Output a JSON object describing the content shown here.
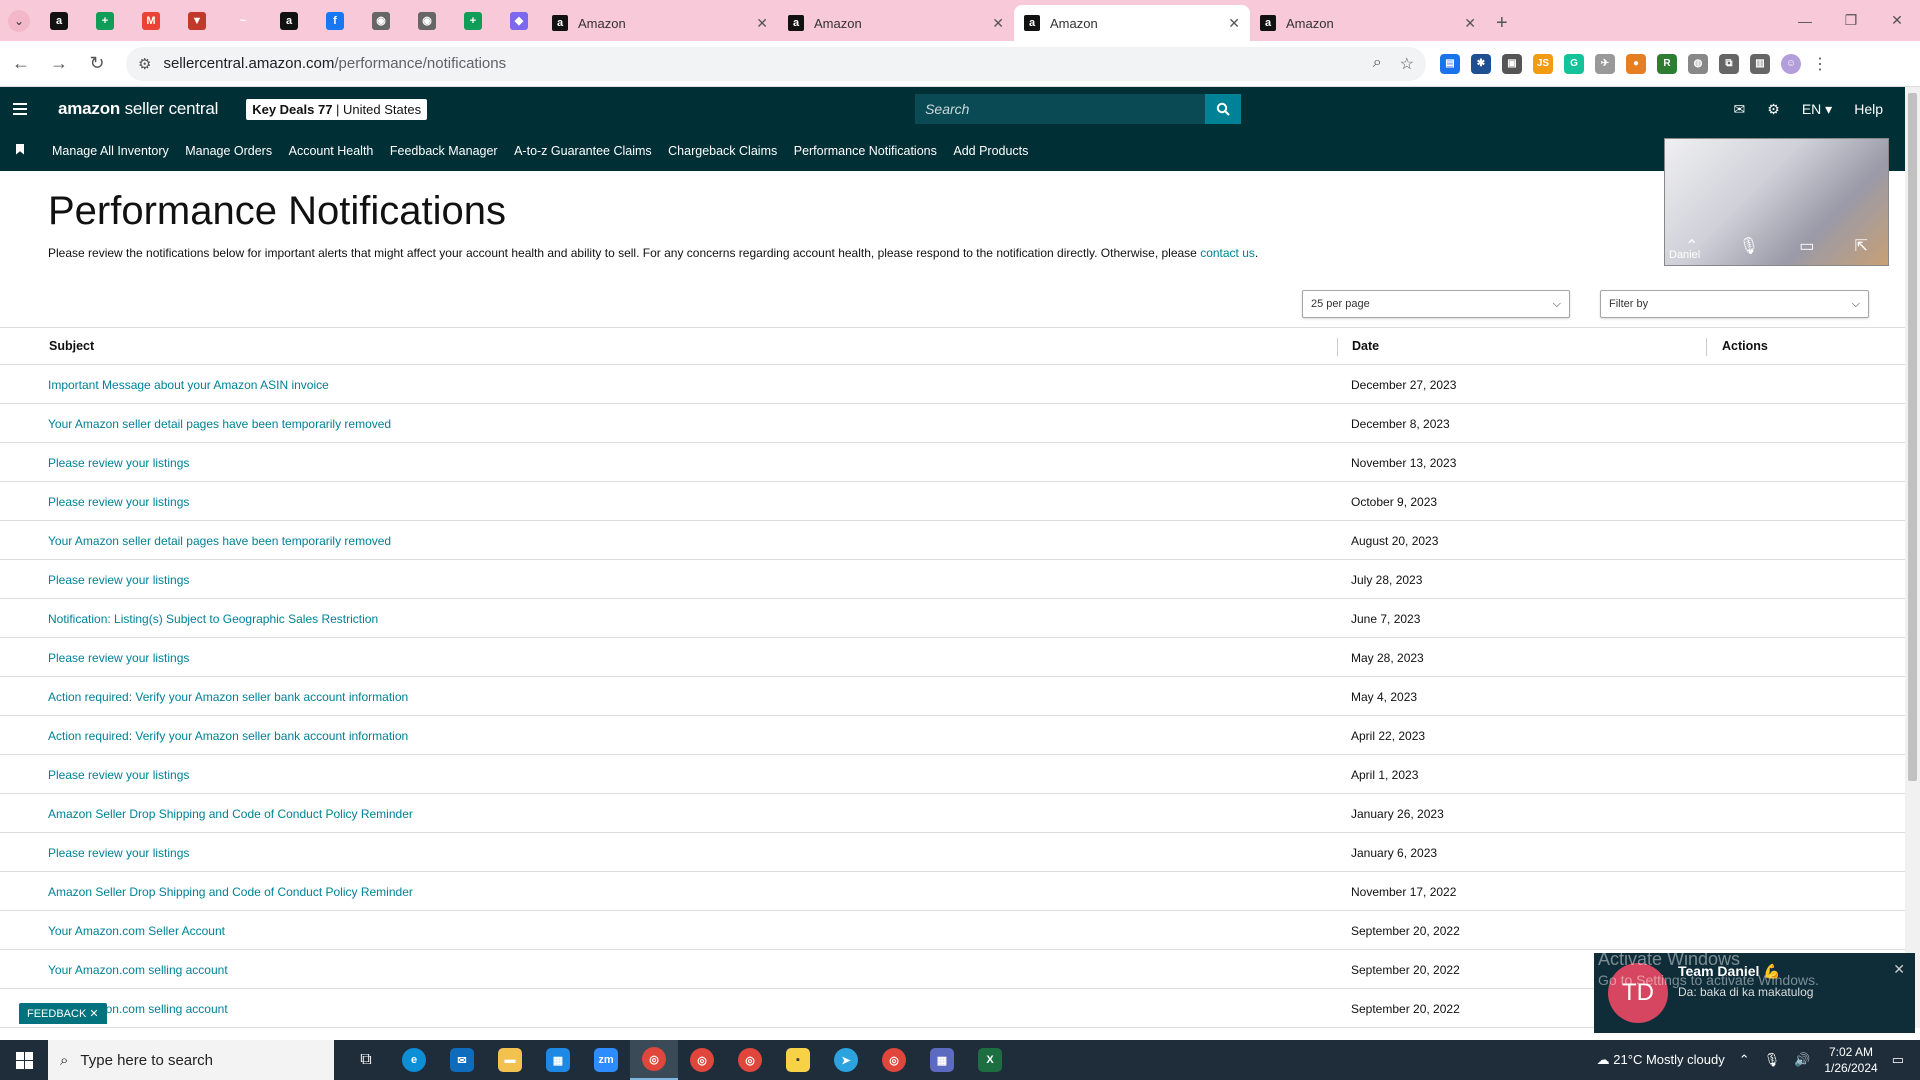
{
  "browser": {
    "pinned_tabs": [
      {
        "icon": "amazon-icon",
        "color": "#111111",
        "glyph": "a"
      },
      {
        "icon": "sheets-icon",
        "color": "#0f9d58",
        "glyph": "+"
      },
      {
        "icon": "gmail-icon",
        "color": "#ea4335",
        "glyph": "M"
      },
      {
        "icon": "todoist-icon",
        "color": "#c0392b",
        "glyph": "▼"
      },
      {
        "icon": "signature-icon",
        "color": "#f8c9d8",
        "glyph": "~"
      },
      {
        "icon": "amazon-icon",
        "color": "#111111",
        "glyph": "a"
      },
      {
        "icon": "facebook-icon",
        "color": "#1877f2",
        "glyph": "f"
      },
      {
        "icon": "globe-icon",
        "color": "#666666",
        "glyph": "◉"
      },
      {
        "icon": "globe-icon",
        "color": "#666666",
        "glyph": "◉"
      },
      {
        "icon": "sheets-icon",
        "color": "#0f9d58",
        "glyph": "+"
      },
      {
        "icon": "clickup-icon",
        "color": "#7b68ee",
        "glyph": "◆"
      }
    ],
    "tabs": [
      {
        "title": "Amazon",
        "active": false
      },
      {
        "title": "Amazon",
        "active": false
      },
      {
        "title": "Amazon",
        "active": true
      },
      {
        "title": "Amazon",
        "active": false
      }
    ],
    "url_host": "sellercentral.amazon.com",
    "url_path": "/performance/notifications"
  },
  "header": {
    "logo_bold": "amazon",
    "logo_rest": " seller central",
    "store_name": "Key Deals 77",
    "store_region": "United States",
    "search_placeholder": "Search",
    "language": "EN",
    "help": "Help"
  },
  "nav": {
    "items": [
      "Manage All Inventory",
      "Manage Orders",
      "Account Health",
      "Feedback Manager",
      "A-to-z Guarantee Claims",
      "Chargeback Claims",
      "Performance Notifications",
      "Add Products"
    ]
  },
  "page": {
    "title": "Performance Notifications",
    "intro": "Please review the notifications below for important alerts that might affect your account health and ability to sell. For any concerns regarding account health, please respond to the notification directly. Otherwise, please ",
    "contact_link": "contact us",
    "intro_end": ".",
    "per_page": "25 per page",
    "filter_placeholder": "Filter by"
  },
  "table": {
    "headers": {
      "subject": "Subject",
      "date": "Date",
      "actions": "Actions"
    },
    "rows": [
      {
        "subject": "Important Message about your Amazon ASIN invoice",
        "date": "December 27, 2023"
      },
      {
        "subject": "Your Amazon seller detail pages have been temporarily removed",
        "date": "December 8, 2023"
      },
      {
        "subject": "Please review your listings",
        "date": "November 13, 2023"
      },
      {
        "subject": "Please review your listings",
        "date": "October 9, 2023"
      },
      {
        "subject": "Your Amazon seller detail pages have been temporarily removed",
        "date": "August 20, 2023"
      },
      {
        "subject": "Please review your listings",
        "date": "July 28, 2023"
      },
      {
        "subject": "Notification: Listing(s) Subject to Geographic Sales Restriction",
        "date": "June 7, 2023"
      },
      {
        "subject": "Please review your listings",
        "date": "May 28, 2023"
      },
      {
        "subject": "Action required: Verify your Amazon seller bank account information",
        "date": "May 4, 2023"
      },
      {
        "subject": "Action required: Verify your Amazon seller bank account information",
        "date": "April 22, 2023"
      },
      {
        "subject": "Please review your listings",
        "date": "April 1, 2023"
      },
      {
        "subject": "Amazon Seller Drop Shipping and Code of Conduct Policy Reminder",
        "date": "January 26, 2023"
      },
      {
        "subject": "Please review your listings",
        "date": "January 6, 2023"
      },
      {
        "subject": "Amazon Seller Drop Shipping and Code of Conduct Policy Reminder",
        "date": "November 17, 2022"
      },
      {
        "subject": "Your Amazon.com Seller Account",
        "date": "September 20, 2022"
      },
      {
        "subject": "Your Amazon.com selling account",
        "date": "September 20, 2022"
      },
      {
        "subject": "Your Amazon.com selling account",
        "date": "September 20, 2022"
      }
    ]
  },
  "feedback": "FEEDBACK",
  "video": {
    "name": "Daniel"
  },
  "toast": {
    "initials": "TD",
    "title": "Team Daniel 💪",
    "message": "Da: baka di ka makatulog",
    "activate_line1": "Activate Windows",
    "activate_line2": "Go to Settings to activate Windows."
  },
  "taskbar": {
    "search_placeholder": "Type here to search",
    "weather": "21°C  Mostly cloudy",
    "time": "7:02 AM",
    "date": "1/26/2024"
  }
}
